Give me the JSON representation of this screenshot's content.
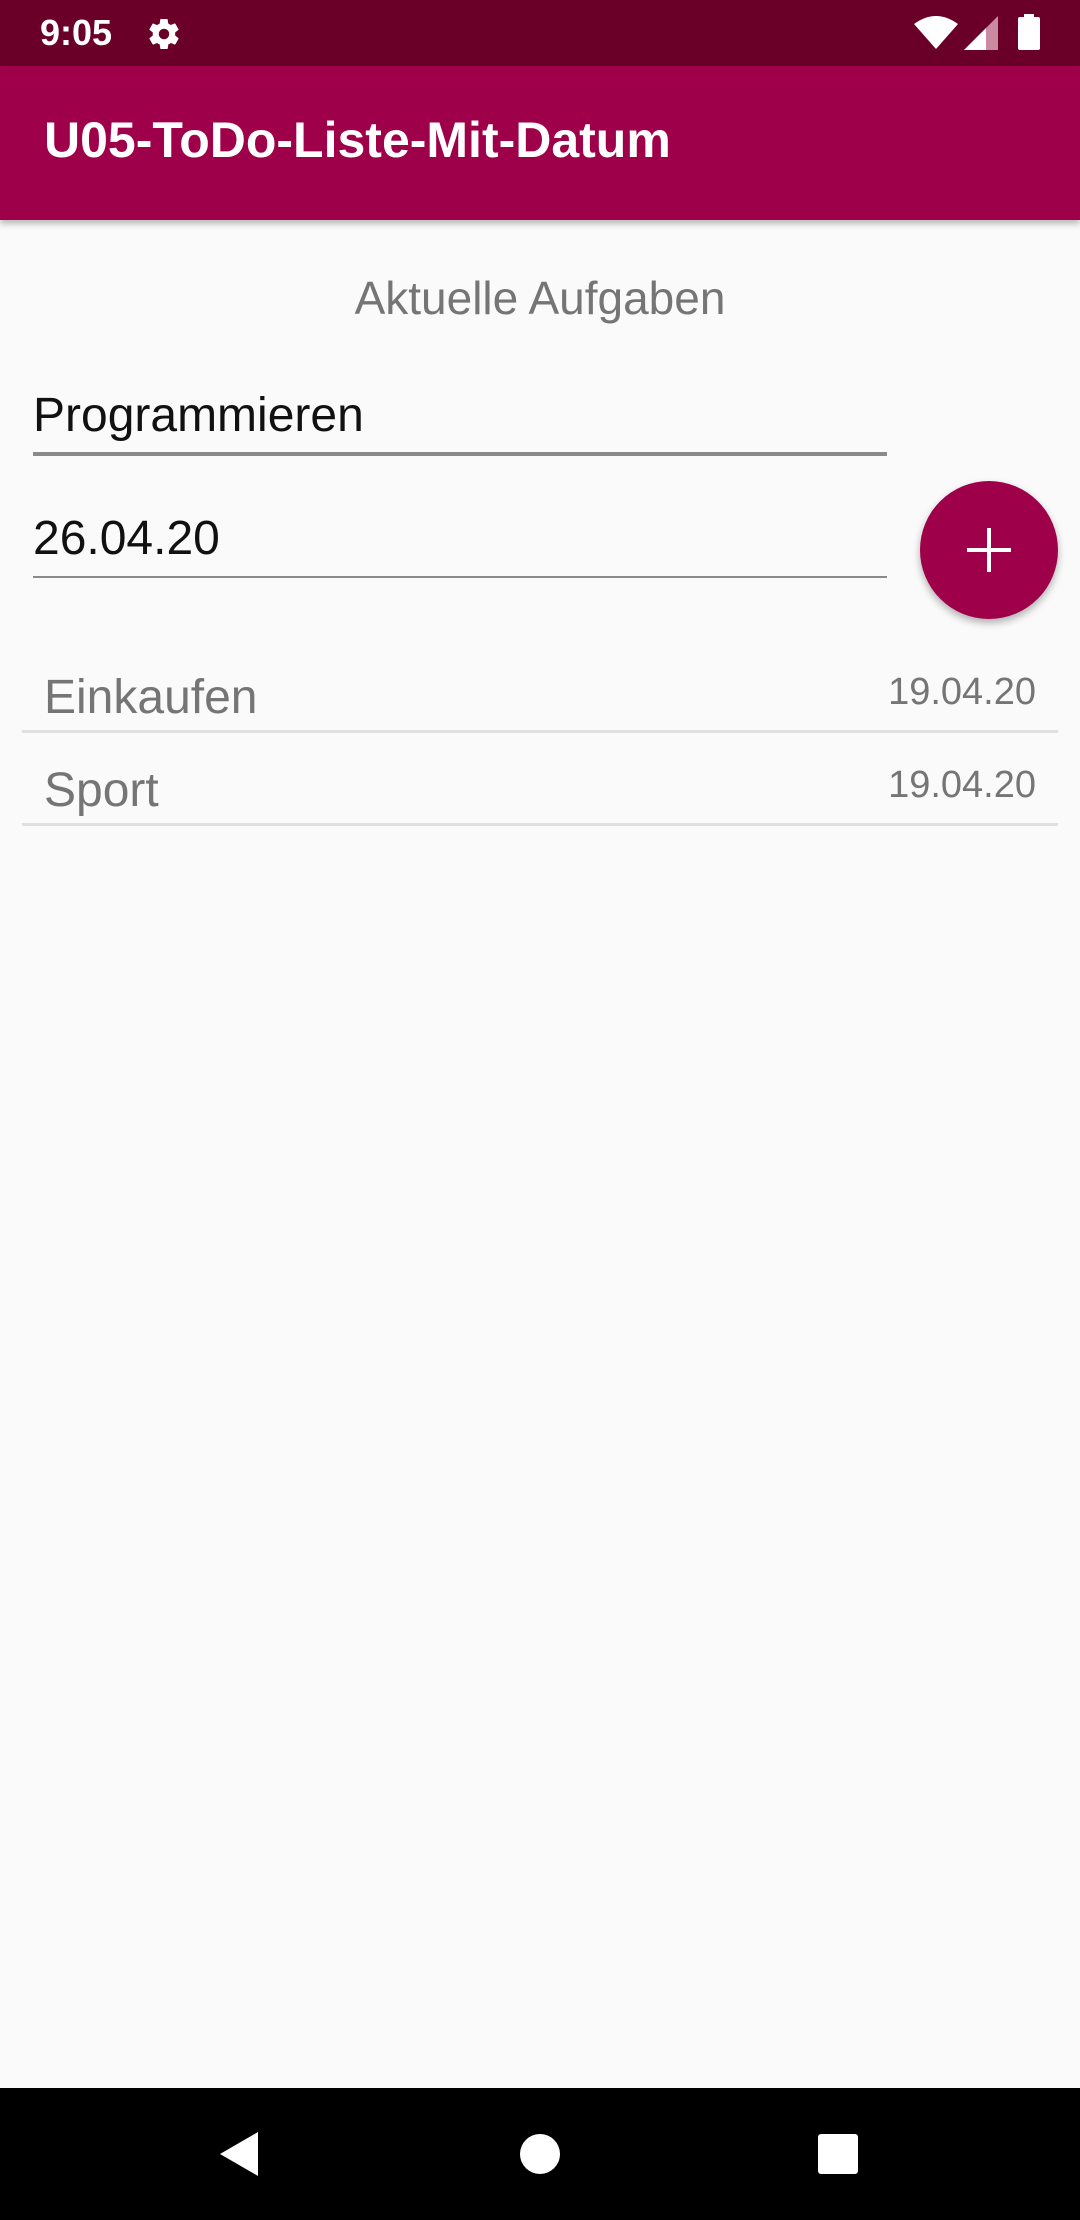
{
  "status_bar": {
    "time": "9:05",
    "icons": [
      "gear-icon",
      "wifi-icon",
      "signal-icon",
      "battery-icon"
    ],
    "background": "#6a0027"
  },
  "app_bar": {
    "title": "U05-ToDo-Liste-Mit-Datum",
    "background": "#9e0049"
  },
  "main": {
    "section_title": "Aktuelle Aufgaben",
    "task_input": {
      "value": "Programmieren"
    },
    "date_input": {
      "value": "26.04.20"
    },
    "add_button": {
      "icon": "plus-icon",
      "color": "#9e0049"
    },
    "todos": [
      {
        "name": "Einkaufen",
        "date": "19.04.20"
      },
      {
        "name": "Sport",
        "date": "19.04.20"
      }
    ]
  },
  "nav_bar": {
    "buttons": [
      "back-icon",
      "home-icon",
      "recents-icon"
    ]
  }
}
